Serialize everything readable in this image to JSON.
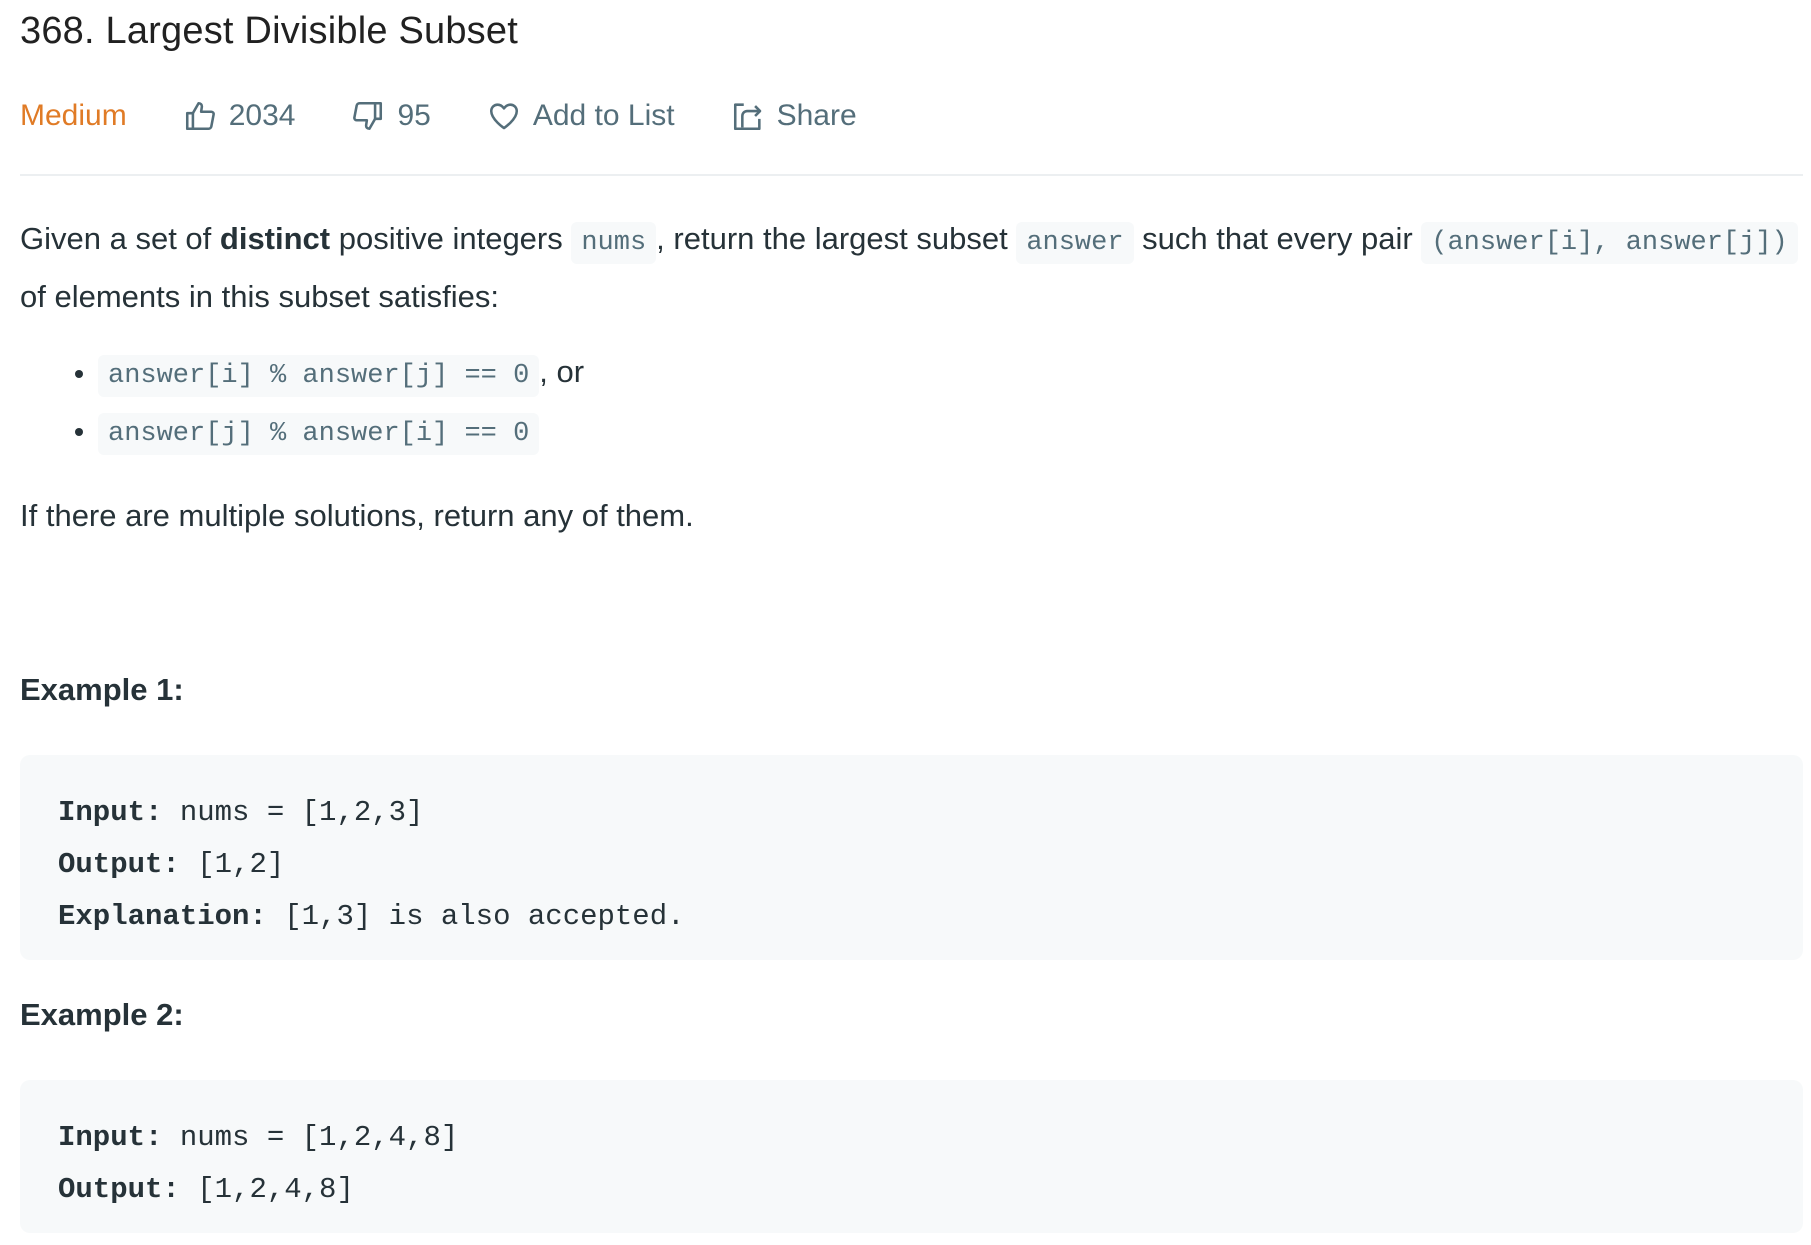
{
  "problem": {
    "title": "368. Largest Divisible Subset",
    "difficulty": "Medium",
    "difficulty_color": "#e07b26",
    "likes": "2034",
    "dislikes": "95",
    "add_to_list_label": "Add to List",
    "share_label": "Share"
  },
  "description": {
    "p1_a": "Given a set of ",
    "p1_bold": "distinct",
    "p1_b": " positive integers ",
    "p1_code1": "nums",
    "p1_c": ", return the largest subset ",
    "p1_code2": "answer",
    "p1_d": " such that every pair ",
    "p1_code3": "(answer[i], answer[j])",
    "p1_e": " of elements in this subset satisfies:",
    "conditions": [
      {
        "code": "answer[i] % answer[j] == 0",
        "suffix": ", or"
      },
      {
        "code": "answer[j] % answer[i] == 0",
        "suffix": ""
      }
    ],
    "p2": "If there are multiple solutions, return any of them."
  },
  "examples": [
    {
      "heading": "Example 1:",
      "lines": [
        {
          "label": "Input:",
          "value": " nums = [1,2,3]"
        },
        {
          "label": "Output:",
          "value": " [1,2]"
        },
        {
          "label": "Explanation:",
          "value": " [1,3] is also accepted."
        }
      ]
    },
    {
      "heading": "Example 2:",
      "lines": [
        {
          "label": "Input:",
          "value": " nums = [1,2,4,8]"
        },
        {
          "label": "Output:",
          "value": " [1,2,4,8]"
        }
      ]
    }
  ],
  "icons": {
    "like": "thumbs-up-icon",
    "dislike": "thumbs-down-icon",
    "add_to_list": "heart-icon",
    "share": "share-icon"
  }
}
